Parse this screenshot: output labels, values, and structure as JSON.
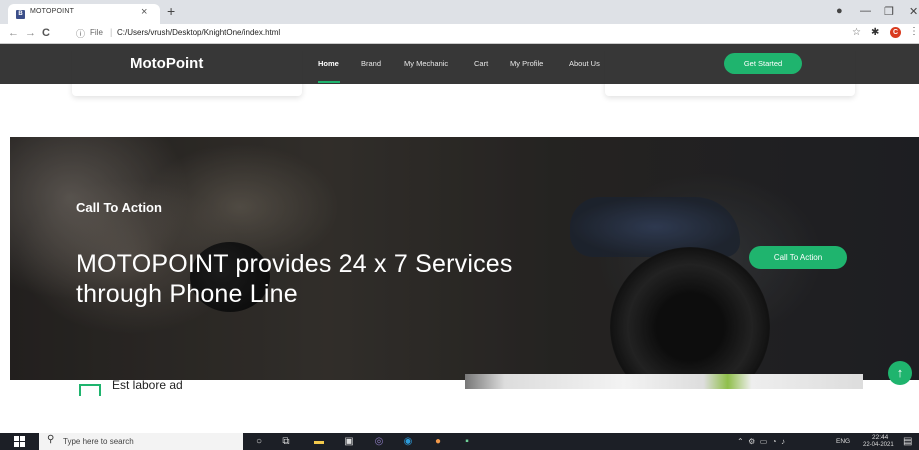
{
  "browser": {
    "tab_title": "MOTOPOINT",
    "favicon_letter": "B",
    "tab_close": "×",
    "new_tab": "+",
    "back": "←",
    "forward": "→",
    "reload": "C",
    "url_info": "ⓘ",
    "url_scheme": "File",
    "url_sep": "|",
    "url_path": "C:/Users/vrush/Desktop/KnightOne/index.html",
    "profile_initial": "C",
    "icons": [
      "star-icon",
      "puzzle-icon",
      "menu-icon"
    ]
  },
  "header": {
    "logo": "MotoPoint",
    "nav": [
      "Home",
      "Brand",
      "My Mechanic",
      "Cart",
      "My Profile",
      "About Us"
    ],
    "active_nav": "Home",
    "cta_button": "Get Started"
  },
  "cta": {
    "title": "Call To Action",
    "headline_line1": "MOTOPOINT provides 24 x 7 Services",
    "headline_line2": "through Phone Line",
    "button": "Call To Action"
  },
  "feature": {
    "title": "Est labore ad"
  },
  "taskbar": {
    "search_placeholder": "Type here to search",
    "lang": "ENG",
    "time": "22:44",
    "date": "22-04-2021"
  },
  "colors": {
    "accent": "#1fb46e",
    "header_bg": "#282828"
  }
}
